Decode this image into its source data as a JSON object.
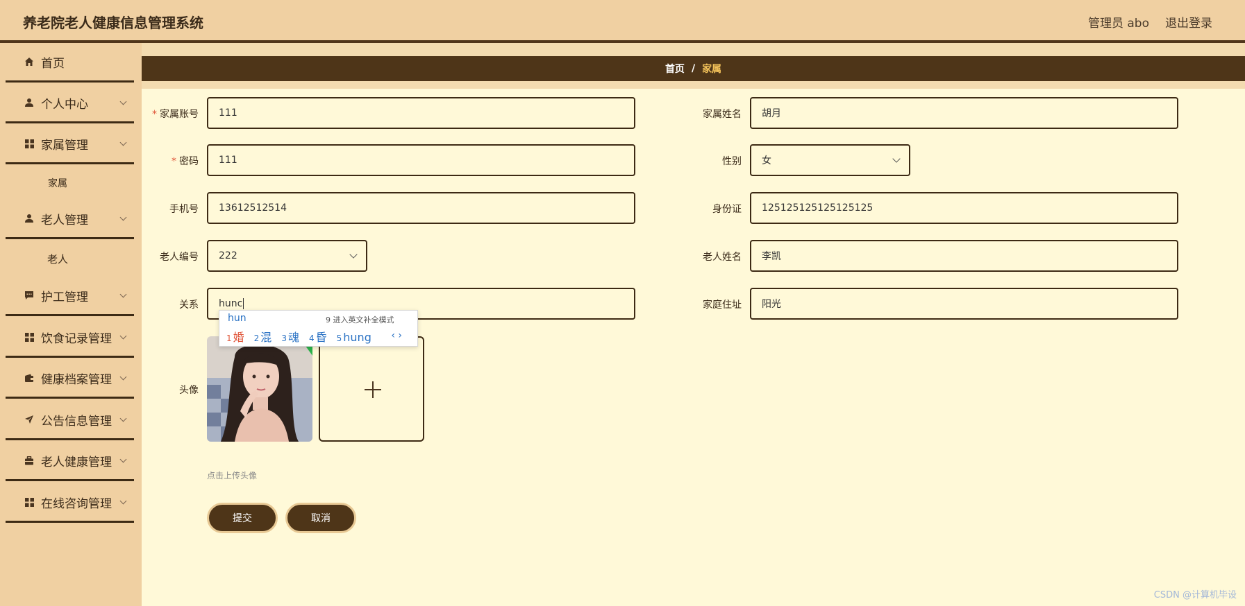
{
  "app": {
    "title": "养老院老人健康信息管理系统",
    "admin_label": "管理员 abo",
    "logout": "退出登录"
  },
  "sidebar": {
    "items": [
      {
        "label": "首页",
        "icon": "home-icon"
      },
      {
        "label": "个人中心",
        "icon": "user-icon"
      },
      {
        "label": "家属管理",
        "icon": "grid-icon"
      },
      {
        "label": "老人管理",
        "icon": "user-icon"
      },
      {
        "label": "护工管理",
        "icon": "chat-icon"
      },
      {
        "label": "饮食记录管理",
        "icon": "grid-icon"
      },
      {
        "label": "健康档案管理",
        "icon": "wallet-icon"
      },
      {
        "label": "公告信息管理",
        "icon": "send-icon"
      },
      {
        "label": "老人健康管理",
        "icon": "briefcase-icon"
      },
      {
        "label": "在线咨询管理",
        "icon": "grid-icon"
      }
    ],
    "sub_family": "家属",
    "sub_elder": "老人"
  },
  "breadcrumb": {
    "home": "首页",
    "separator": "/",
    "current": "家属"
  },
  "form": {
    "family_account": {
      "label": "家属账号",
      "value": "111"
    },
    "family_name": {
      "label": "家属姓名",
      "value": "胡月"
    },
    "password": {
      "label": "密码",
      "value": "111"
    },
    "gender": {
      "label": "性别",
      "value": "女"
    },
    "phone": {
      "label": "手机号",
      "value": "13612512514"
    },
    "id_card": {
      "label": "身份证",
      "value": "125125125125125125"
    },
    "elder_no": {
      "label": "老人编号",
      "value": "222"
    },
    "elder_name": {
      "label": "老人姓名",
      "value": "李凯"
    },
    "relation": {
      "label": "关系",
      "value": "hunc"
    },
    "address": {
      "label": "家庭住址",
      "value": "阳光"
    },
    "avatar": {
      "label": "头像",
      "hint": "点击上传头像"
    },
    "required_mark": "*"
  },
  "buttons": {
    "submit": "提交",
    "cancel": "取消"
  },
  "ime": {
    "composition": "hun",
    "hint": "9 进入英文补全模式",
    "candidates": [
      {
        "n": "1",
        "text": "婚"
      },
      {
        "n": "2",
        "text": "混"
      },
      {
        "n": "3",
        "text": "魂"
      },
      {
        "n": "4",
        "text": "昏"
      },
      {
        "n": "5",
        "text": "hung"
      }
    ],
    "pager": "‹ ›"
  },
  "watermark": "CSDN @计算机毕设",
  "colors": {
    "header_bg": "#f0d0a2",
    "accent_dark": "#4e3518",
    "content_bg": "#fff9d8",
    "crumb_current": "#f3c25a",
    "required": "#e0563a"
  }
}
